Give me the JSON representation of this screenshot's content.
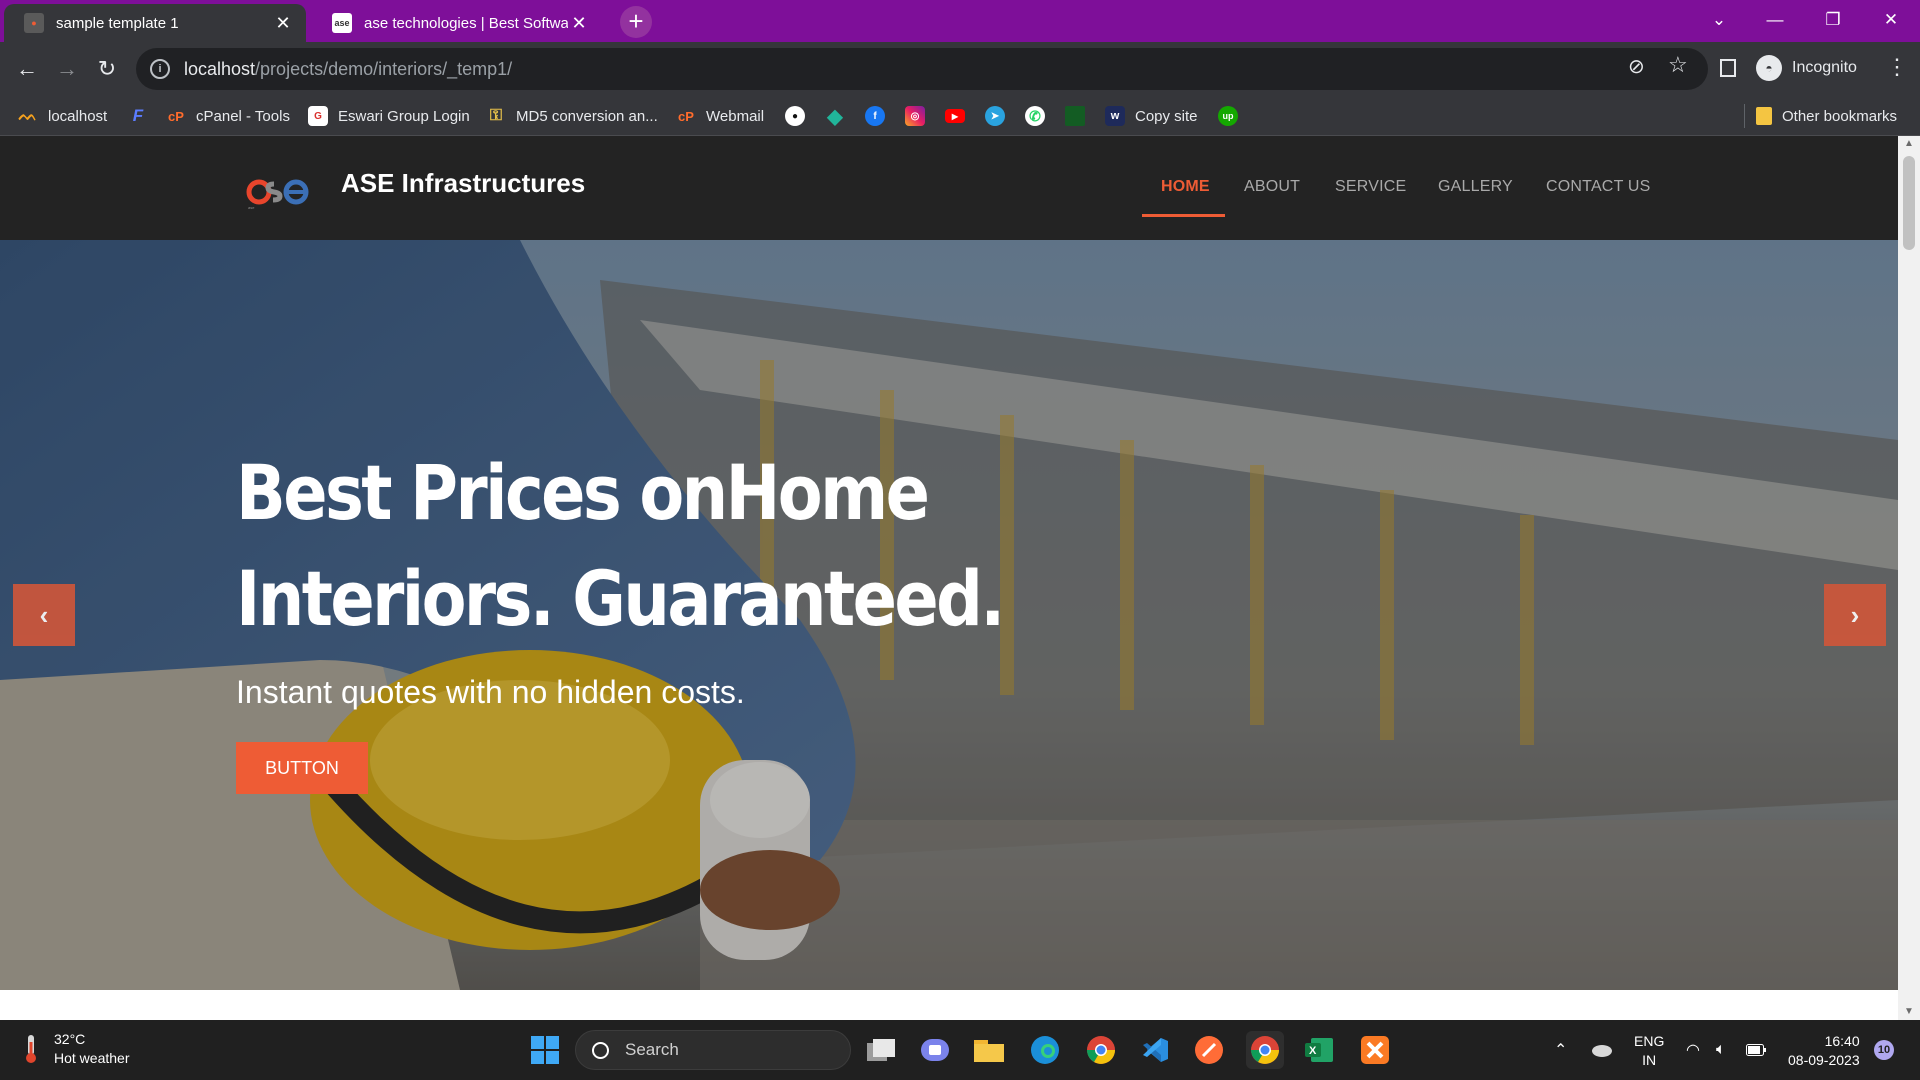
{
  "browser": {
    "tabs": [
      {
        "title": "sample template 1",
        "active": true
      },
      {
        "title": "ase technologies | Best Software",
        "active": false
      }
    ],
    "url_host": "localhost",
    "url_path": "/projects/demo/interiors/_temp1/",
    "profile_label": "Incognito",
    "bookmarks": [
      {
        "label": "localhost",
        "icon": "xampp-icon"
      },
      {
        "label": "",
        "icon": "f-icon"
      },
      {
        "label": "cPanel - Tools",
        "icon": "cpanel-icon"
      },
      {
        "label": "Eswari Group Login",
        "icon": "g-icon"
      },
      {
        "label": "MD5 conversion an...",
        "icon": "key-icon"
      },
      {
        "label": "Webmail",
        "icon": "cpanel-icon"
      },
      {
        "label": "",
        "icon": "github-icon"
      },
      {
        "label": "",
        "icon": "diamond-icon"
      },
      {
        "label": "",
        "icon": "facebook-icon"
      },
      {
        "label": "",
        "icon": "instagram-icon"
      },
      {
        "label": "",
        "icon": "youtube-icon"
      },
      {
        "label": "",
        "icon": "telegram-icon"
      },
      {
        "label": "",
        "icon": "whatsapp-icon"
      },
      {
        "label": "",
        "icon": "sheet-icon"
      },
      {
        "label": "Copy site",
        "icon": "w-icon"
      },
      {
        "label": "",
        "icon": "upwork-icon"
      }
    ],
    "other_bookmarks": "Other bookmarks"
  },
  "site": {
    "brand": "ASE Infrastructures",
    "logo_text": "ase",
    "menu": [
      "HOME",
      "ABOUT",
      "SERVICE",
      "GALLERY",
      "CONTACT US"
    ],
    "active_menu": "HOME",
    "hero": {
      "title": "Best Prices onHome Interiors. Guaranteed.",
      "subtitle": "Instant quotes with no hidden costs.",
      "button": "BUTTON"
    },
    "colors": {
      "accent": "#ee5c35",
      "nav_bg": "#232323"
    }
  },
  "taskbar": {
    "weather_temp": "32°C",
    "weather_desc": "Hot weather",
    "search_label": "Search",
    "lang_line1": "ENG",
    "lang_line2": "IN",
    "time": "16:40",
    "date": "08-09-2023",
    "notification_count": "10"
  }
}
